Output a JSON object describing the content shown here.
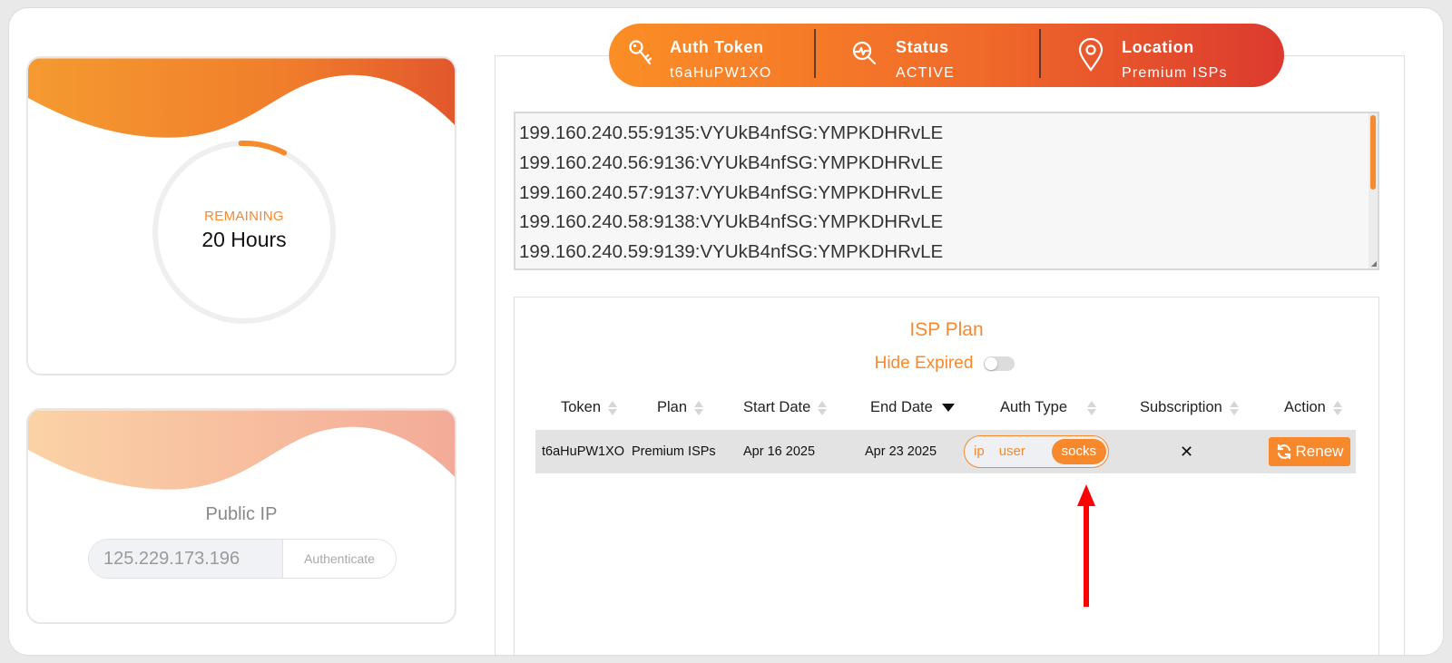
{
  "timer_card": {
    "remaining_label": "REMAINING",
    "remaining_value": "20 Hours",
    "progress_fraction": 0.08
  },
  "ip_card": {
    "title": "Public IP",
    "ip_value": "125.229.173.196",
    "authenticate_label": "Authenticate"
  },
  "header": {
    "auth_token": {
      "label": "Auth Token",
      "value": "t6aHuPW1XO",
      "icon": "key-icon"
    },
    "status": {
      "label": "Status",
      "value": "ACTIVE",
      "icon": "monitor-search-icon"
    },
    "location": {
      "label": "Location",
      "value": "Premium ISPs",
      "icon": "map-pin-icon"
    }
  },
  "proxies": [
    "199.160.240.55:9135:VYUkB4nfSG:YMPKDHRvLE",
    "199.160.240.56:9136:VYUkB4nfSG:YMPKDHRvLE",
    "199.160.240.57:9137:VYUkB4nfSG:YMPKDHRvLE",
    "199.160.240.58:9138:VYUkB4nfSG:YMPKDHRvLE",
    "199.160.240.59:9139:VYUkB4nfSG:YMPKDHRvLE"
  ],
  "plan": {
    "title": "ISP Plan",
    "hide_expired_label": "Hide Expired",
    "hide_expired_on": false,
    "columns": [
      "Token",
      "Plan",
      "Start Date",
      "End Date",
      "Auth Type",
      "Subscription",
      "Action"
    ],
    "rows": [
      {
        "token": "t6aHuPW1XO",
        "plan": "Premium ISPs",
        "start_date": "Apr 16 2025",
        "end_date": "Apr 23 2025",
        "auth_options": [
          "ip",
          "user",
          "socks"
        ],
        "auth_selected": "socks",
        "subscription": "✕",
        "action_label": "Renew"
      }
    ]
  },
  "colors": {
    "accent": "#f7892c",
    "gradient_start": "#fb8e26",
    "gradient_end": "#dc3a2e",
    "annotation_arrow": "#ff0000"
  }
}
